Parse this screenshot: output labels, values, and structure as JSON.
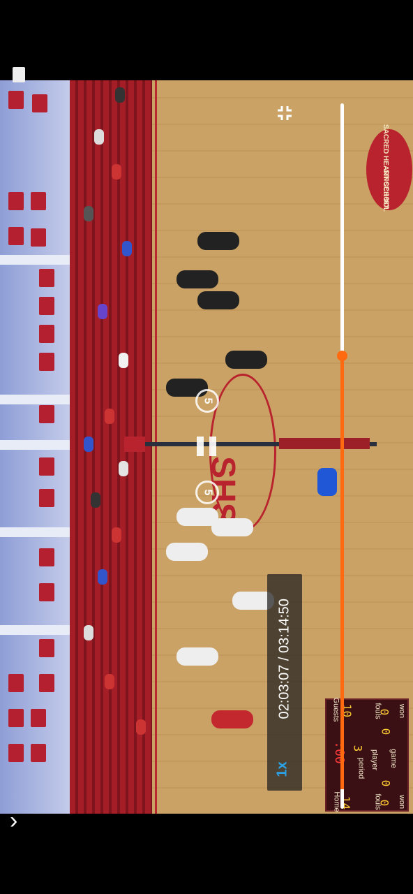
{
  "player": {
    "time_display": "02:03:07 / 03:14:50",
    "speed_label": "1x",
    "rewind_seconds": "5",
    "forward_seconds": "5",
    "progress_fraction": 0.607
  },
  "scoreboard": {
    "home_label": "Home",
    "home_score": "14",
    "guests_label": "Guests",
    "guests_score": "10",
    "clock": ":00",
    "period_label": "period",
    "period_value": "3",
    "player_label": "player",
    "fouls_left_label": "fouls",
    "fouls_right_label": "fouls",
    "fouls_left_value": "0",
    "fouls_right_value": "0",
    "game_label": "game",
    "won_left_label": "won",
    "won_right_label": "won",
    "won_left_value": "0",
    "won_right_value": "0"
  },
  "court": {
    "center_logo_text": "SHS",
    "school_logo_text": "SACRED HEART SCHOOL",
    "since_text": "SINCE 1887"
  },
  "icons": {
    "collapse": "collapse-icon",
    "chevron": "chevron-right-icon",
    "pause": "pause-icon"
  },
  "colors": {
    "accent": "#ff6a10",
    "speed": "#2aa2e8"
  }
}
